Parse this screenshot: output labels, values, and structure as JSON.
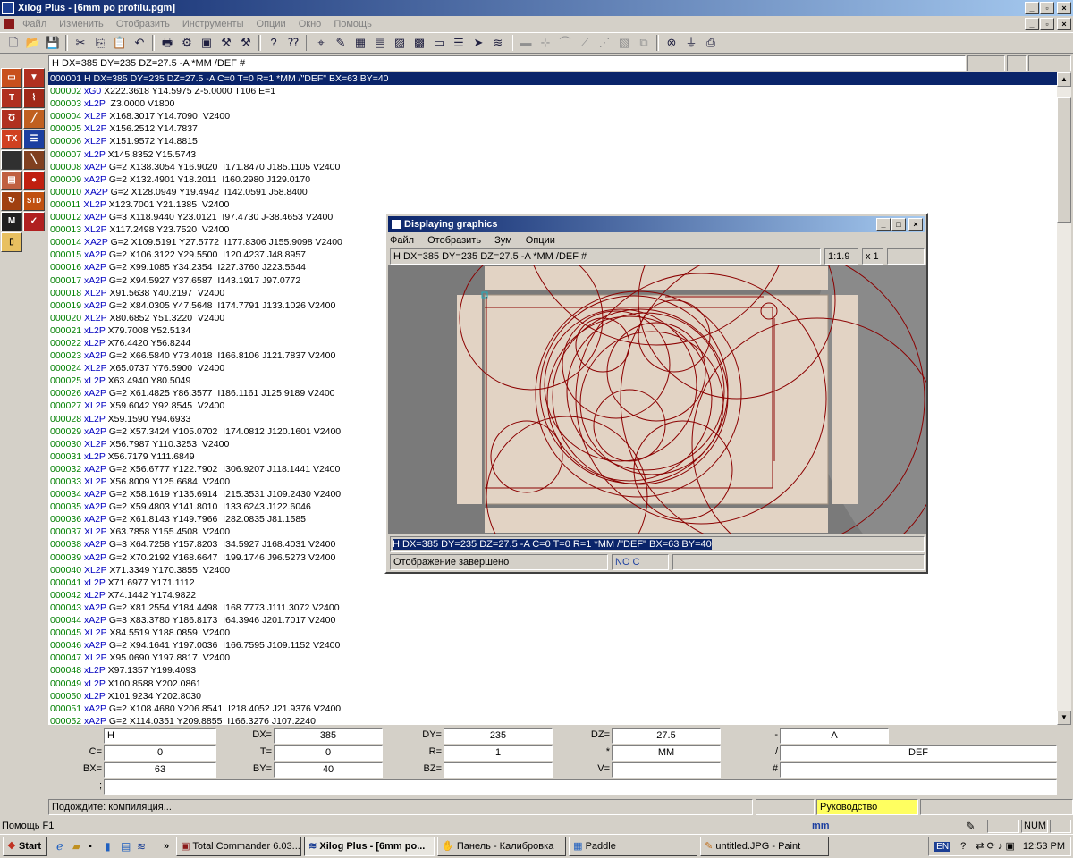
{
  "window": {
    "title": "Xilog Plus - [6mm po profilu.pgm]"
  },
  "menu": [
    "Файл",
    "Изменить",
    "Отобразить",
    "Инструменты",
    "Опции",
    "Окно",
    "Помощь"
  ],
  "header_line": "H DX=385 DY=235 DZ=27.5 -A *MM /DEF #",
  "code_lines": [
    {
      "n": "000001",
      "c": "H",
      "t": "DX=385 DY=235 DZ=27.5 -A C=0 T=0 R=1 *MM /\"DEF\" BX=63 BY=40"
    },
    {
      "n": "000002",
      "c": "xG0",
      "t": "X222.3618 Y14.5975 Z-5.0000 T106 E=1"
    },
    {
      "n": "000003",
      "c": "xL2P",
      "t": " Z3.0000 V1800"
    },
    {
      "n": "000004",
      "c": "XL2P",
      "t": "X168.3017 Y14.7090  V2400"
    },
    {
      "n": "000005",
      "c": "XL2P",
      "t": "X156.2512 Y14.7837"
    },
    {
      "n": "000006",
      "c": "XL2P",
      "t": "X151.9572 Y14.8815"
    },
    {
      "n": "000007",
      "c": "xL2P",
      "t": "X145.8352 Y15.5743"
    },
    {
      "n": "000008",
      "c": "xA2P",
      "t": "G=2 X138.3054 Y16.9020  I171.8470 J185.1105 V2400"
    },
    {
      "n": "000009",
      "c": "xA2P",
      "t": "G=2 X132.4901 Y18.2011  I160.2980 J129.0170"
    },
    {
      "n": "000010",
      "c": "XA2P",
      "t": "G=2 X128.0949 Y19.4942  I142.0591 J58.8400"
    },
    {
      "n": "000011",
      "c": "XL2P",
      "t": "X123.7001 Y21.1385  V2400"
    },
    {
      "n": "000012",
      "c": "xA2P",
      "t": "G=3 X118.9440 Y23.0121  I97.4730 J-38.4653 V2400"
    },
    {
      "n": "000013",
      "c": "XL2P",
      "t": "X117.2498 Y23.7520  V2400"
    },
    {
      "n": "000014",
      "c": "XA2P",
      "t": "G=2 X109.5191 Y27.5772  I177.8306 J155.9098 V2400"
    },
    {
      "n": "000015",
      "c": "xA2P",
      "t": "G=2 X106.3122 Y29.5500  I120.4237 J48.8957"
    },
    {
      "n": "000016",
      "c": "xA2P",
      "t": "G=2 X99.1085 Y34.2354  I227.3760 J223.5644"
    },
    {
      "n": "000017",
      "c": "xA2P",
      "t": "G=2 X94.5927 Y37.6587  I143.1917 J97.0772"
    },
    {
      "n": "000018",
      "c": "XL2P",
      "t": "X91.5638 Y40.2197  V2400"
    },
    {
      "n": "000019",
      "c": "xA2P",
      "t": "G=2 X84.0305 Y47.5648  I174.7791 J133.1026 V2400"
    },
    {
      "n": "000020",
      "c": "XL2P",
      "t": "X80.6852 Y51.3220  V2400"
    },
    {
      "n": "000021",
      "c": "xL2P",
      "t": "X79.7008 Y52.5134"
    },
    {
      "n": "000022",
      "c": "xL2P",
      "t": "X76.4420 Y56.8244"
    },
    {
      "n": "000023",
      "c": "xA2P",
      "t": "G=2 X66.5840 Y73.4018  I166.8106 J121.7837 V2400"
    },
    {
      "n": "000024",
      "c": "XL2P",
      "t": "X65.0737 Y76.5900  V2400"
    },
    {
      "n": "000025",
      "c": "xL2P",
      "t": "X63.4940 Y80.5049"
    },
    {
      "n": "000026",
      "c": "xA2P",
      "t": "G=2 X61.4825 Y86.3577  I186.1161 J125.9189 V2400"
    },
    {
      "n": "000027",
      "c": "XL2P",
      "t": "X59.6042 Y92.8545  V2400"
    },
    {
      "n": "000028",
      "c": "xL2P",
      "t": "X59.1590 Y94.6933"
    },
    {
      "n": "000029",
      "c": "xA2P",
      "t": "G=2 X57.3424 Y105.0702  I174.0812 J120.1601 V2400"
    },
    {
      "n": "000030",
      "c": "XL2P",
      "t": "X56.7987 Y110.3253  V2400"
    },
    {
      "n": "000031",
      "c": "xL2P",
      "t": "X56.7179 Y111.6849"
    },
    {
      "n": "000032",
      "c": "xA2P",
      "t": "G=2 X56.6777 Y122.7902  I306.9207 J118.1441 V2400"
    },
    {
      "n": "000033",
      "c": "XL2P",
      "t": "X56.8009 Y125.6684  V2400"
    },
    {
      "n": "000034",
      "c": "xA2P",
      "t": "G=2 X58.1619 Y135.6914  I215.3531 J109.2430 V2400"
    },
    {
      "n": "000035",
      "c": "xA2P",
      "t": "G=2 X59.4803 Y141.8010  I133.6243 J122.6046"
    },
    {
      "n": "000036",
      "c": "xA2P",
      "t": "G=2 X61.8143 Y149.7966  I282.0835 J81.1585"
    },
    {
      "n": "000037",
      "c": "XL2P",
      "t": "X63.7858 Y155.4508  V2400"
    },
    {
      "n": "000038",
      "c": "xA2P",
      "t": "G=3 X64.7258 Y157.8203  I34.5927 J168.4031 V2400"
    },
    {
      "n": "000039",
      "c": "xA2P",
      "t": "G=2 X70.2192 Y168.6647  I199.1746 J96.5273 V2400"
    },
    {
      "n": "000040",
      "c": "XL2P",
      "t": "X71.3349 Y170.3855  V2400"
    },
    {
      "n": "000041",
      "c": "xL2P",
      "t": "X71.6977 Y171.1112"
    },
    {
      "n": "000042",
      "c": "xL2P",
      "t": "X74.1442 Y174.9822"
    },
    {
      "n": "000043",
      "c": "xA2P",
      "t": "G=2 X81.2554 Y184.4498  I168.7773 J111.3072 V2400"
    },
    {
      "n": "000044",
      "c": "xA2P",
      "t": "G=3 X83.3780 Y186.8173  I64.3946 J201.7017 V2400"
    },
    {
      "n": "000045",
      "c": "XL2P",
      "t": "X84.5519 Y188.0859  V2400"
    },
    {
      "n": "000046",
      "c": "xA2P",
      "t": "G=2 X94.1641 Y197.0036  I166.7595 J109.1152 V2400"
    },
    {
      "n": "000047",
      "c": "XL2P",
      "t": "X95.0690 Y197.8817  V2400"
    },
    {
      "n": "000048",
      "c": "xL2P",
      "t": "X97.1357 Y199.4093"
    },
    {
      "n": "000049",
      "c": "xL2P",
      "t": "X100.8588 Y202.0861"
    },
    {
      "n": "000050",
      "c": "xL2P",
      "t": "X101.9234 Y202.8030"
    },
    {
      "n": "000051",
      "c": "xA2P",
      "t": "G=2 X108.4680 Y206.8541  I218.4052 J21.9376 V2400"
    },
    {
      "n": "000052",
      "c": "xA2P",
      "t": "G=2 X114.0351 Y209.8855  I166.3276 J107.2240"
    }
  ],
  "params": {
    "h_value": "H",
    "dx_label": "DX=",
    "dx": "385",
    "dy_label": "DY=",
    "dy": "235",
    "dz_label": "DZ=",
    "dz": "27.5",
    "minus_label": "-",
    "minus": "A",
    "c_label": "C=",
    "c": "0",
    "t_label": "T=",
    "t": "0",
    "r_label": "R=",
    "r": "1",
    "star_label": "*",
    "star": "MM",
    "slash_label": "/",
    "slash": "DEF",
    "bx_label": "BX=",
    "bx": "63",
    "by_label": "BY=",
    "by": "40",
    "bz_label": "BZ=",
    "bz": "",
    "v_label": "V=",
    "v": "",
    "hash_label": "#",
    "hash": "",
    "extra_label": ";",
    "extra": ""
  },
  "status": {
    "compile": "Подождите: компиляция...",
    "guide": "Руководство",
    "help": "Помощь F1",
    "unit": "mm",
    "num": "NUM"
  },
  "graphics_window": {
    "title": "Displaying graphics",
    "menu": [
      "Файл",
      "Отобразить",
      "Зум",
      "Опции"
    ],
    "header": "H DX=385 DY=235 DZ=27.5 -A *MM /DEF #",
    "scale": "1:1.9",
    "zoom": "x 1",
    "command": "H DX=385 DY=235 DZ=27.5 -A C=0 T=0 R=1 *MM /\"DEF\" BX=63 BY=40",
    "status": "Отображение завершено",
    "noc": "NO C"
  },
  "taskbar": {
    "start": "Start",
    "overflow": "»",
    "tasks": [
      {
        "label": "Total Commander 6.03...",
        "active": false
      },
      {
        "label": "Xilog Plus - [6mm po...",
        "active": true
      },
      {
        "label": "Панель - Калибровка",
        "active": false
      },
      {
        "label": "Paddle",
        "active": false
      },
      {
        "label": "untitled.JPG - Paint",
        "active": false
      }
    ],
    "lang": "EN",
    "clock": "12:53 PM"
  },
  "colors": {
    "selection": "#0a246a",
    "line_num": "#008000",
    "command": "#0000c0",
    "drawing": "#8b0000",
    "panel": "#e2d3c4"
  }
}
